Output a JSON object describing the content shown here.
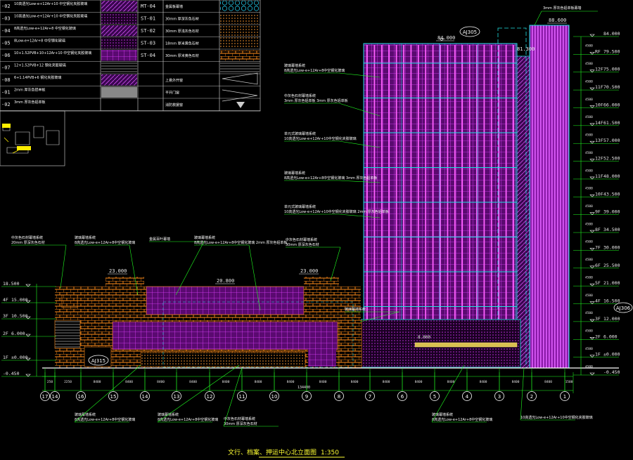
{
  "legend": {
    "rows": [
      {
        "code": "-02",
        "desc": "10高透光Low-e+12Ar+10 中空钢化夹胶玻璃",
        "code2": "MT-04",
        "desc2": "金属板幕墙"
      },
      {
        "code": "-03",
        "desc": "10高透光Low-e+12Ar+10 中空钢化夹胶玻璃",
        "code2": "ST-01",
        "desc2": "30mm 厚深灰色石材"
      },
      {
        "code": "-04",
        "desc": "8高透光Low-e+12Ar+8 中空钢化玻璃",
        "code2": "ST-02",
        "desc2": "30mm 厚浅灰色石材"
      },
      {
        "code": "-05",
        "desc": "8Low-e+12Ar+8 中空钢化玻璃",
        "code2": "ST-03",
        "desc2": "18mm 厚米黄色石材"
      },
      {
        "code": "-06",
        "desc": "10+1.52PVB+10+12Ar+10 中空钢化夹胶玻璃",
        "code2": "ST-04",
        "desc2": "30mm 厚米黄色石材"
      },
      {
        "code": "-07",
        "desc": "12+1.52PVB+12 钢化夹胶玻璃",
        "code2": "",
        "desc2": ""
      },
      {
        "code": "-08",
        "desc": "6+1.14PVB+6 钢化夹胶玻璃",
        "code2": "",
        "desc2": "上悬外开窗"
      },
      {
        "code": "-01",
        "desc": "2mm 厚灰色铝单板",
        "code2": "",
        "desc2": "平开门窗"
      },
      {
        "code": "-02",
        "desc": "3mm 厚灰色铝单板",
        "code2": "",
        "desc2": "消防救援窗"
      }
    ]
  },
  "tags": {
    "top_left": "AJ305",
    "right": "AJ306",
    "bottom_left": "AJ315"
  },
  "elevations_top": {
    "tower_top": "84.000",
    "tower_right_top": "88.600",
    "tower_step": "81.300",
    "podium_left": "23.000",
    "podium_mid": "20.800",
    "podium_right": "23.000",
    "right_floor_mark": "8.000"
  },
  "right_levels": [
    {
      "floor": "",
      "value": "84.000"
    },
    {
      "floor": "RF",
      "value": "79.500"
    },
    {
      "floor": "12F",
      "value": "75.000"
    },
    {
      "floor": "11F",
      "value": "70.500"
    },
    {
      "floor": "10F",
      "value": "66.000"
    },
    {
      "floor": "14F",
      "value": "61.500"
    },
    {
      "floor": "13F",
      "value": "57.000"
    },
    {
      "floor": "12F",
      "value": "52.500"
    },
    {
      "floor": "11F",
      "value": "48.000"
    },
    {
      "floor": "10F",
      "value": "43.500"
    },
    {
      "floor": "9F",
      "value": "39.000"
    },
    {
      "floor": "8F",
      "value": "34.500"
    },
    {
      "floor": "7F",
      "value": "30.000"
    },
    {
      "floor": "6F",
      "value": "25.500"
    },
    {
      "floor": "5F",
      "value": "21.000"
    },
    {
      "floor": "4F",
      "value": "16.500"
    },
    {
      "floor": "3F",
      "value": "12.000"
    },
    {
      "floor": "2F",
      "value": "6.000"
    },
    {
      "floor": "1F",
      "value": "±0.000"
    },
    {
      "floor": "",
      "value": "-0.450"
    }
  ],
  "left_levels": [
    {
      "floor": "",
      "value": "18.500"
    },
    {
      "floor": "4F",
      "value": "15.000"
    },
    {
      "floor": "3F",
      "value": "10.500"
    },
    {
      "floor": "2F",
      "value": "6.000"
    },
    {
      "floor": "1F",
      "value": "±0.000"
    },
    {
      "floor": "",
      "value": "-0.450"
    }
  ],
  "grid_axes": [
    "17",
    "14",
    "16",
    "15",
    "14",
    "13",
    "12",
    "11",
    "10",
    "9",
    "8",
    "7",
    "6",
    "5",
    "4",
    "3",
    "2",
    "1"
  ],
  "dim_values": [
    "250",
    "2250",
    "8400",
    "8400",
    "8400",
    "8400",
    "8400",
    "8400",
    "8400",
    "8400",
    "8400",
    "8400",
    "8400",
    "8400",
    "8400",
    "8400",
    "8400",
    "1500"
  ],
  "total_dim": "134400",
  "annotations_left": [
    "中灰色石材幕墙系统 20mm 厚深灰色石材",
    "玻璃幕墙系统 8高透光Low-e+12Ar+8中空钢化玻璃",
    "金属百叶幕墙",
    "玻璃幕墙系统 8高透光Low-e+12Ar+8中空钢化玻璃 2mm 厚灰色铝单板",
    "中灰色石材幕墙系统 30mm 厚深灰色石材",
    "玻璃幕墙系统"
  ],
  "annotations_tower": [
    "玻璃幕墙系统 8高透光Low-e+12Ar+8中空钢化玻璃",
    "中灰色石材幕墙系统 3mm 厚灰色铝单板 3mm 厚灰色铝单板",
    "单元式玻璃幕墙系统 10高透光Low-e+12Ar+10中空钢化夹胶玻璃",
    "玻璃幕墙系统 8高透光Low-e+12Ar+8中空钢化玻璃 3mm 厚灰色铝单板",
    "单元式玻璃幕墙系统 10高透光Low-e+12Ar+10中空钢化夹胶玻璃 2mm 厚灰色铝单板"
  ],
  "annotations_bottom": [
    "玻璃幕墙系统 8高透光Low-e+12Ar+8中空钢化玻璃",
    "玻璃幕墙系统 8高透光Low-e+12Ar+8中空钢化玻璃",
    "中灰色石材幕墙系统 30mm 厚深灰色石材",
    "玻璃幕墙系统 8高透光Low-e+12Ar+8中空钢化玻璃",
    "10高透光Low-e+12Ar+10中空钢化夹胶玻璃"
  ],
  "top_note": "3mm 厚灰色铝单板幕墙",
  "title": "文行、档案、押运中心北立面图",
  "scale": "1:350",
  "colors": {
    "background": "#000000",
    "magenta": "#e040ff",
    "orange": "#ff8c1a",
    "cyan": "#20e0e0",
    "green": "#20ff20",
    "yellow": "#ffff33",
    "white": "#ffffff"
  }
}
